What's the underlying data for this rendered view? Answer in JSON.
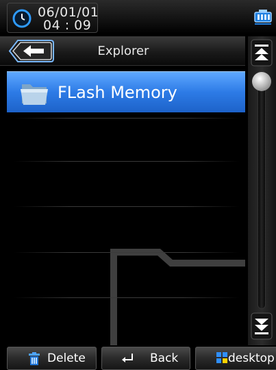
{
  "status_bar": {
    "date": "06/01/01",
    "time": "04 : 09",
    "clock_icon": "clock-icon",
    "battery_icon": "battery-icon",
    "accent_color": "#3aa0ff"
  },
  "title_bar": {
    "title": "Explorer",
    "back_icon": "back-arrow-icon"
  },
  "list": {
    "items": [
      {
        "label": "FLash Memory",
        "icon": "folder-icon",
        "selected": true
      }
    ],
    "selected_color": "#2d7be6"
  },
  "scrollbar": {
    "up_icon": "scroll-up-icon",
    "down_icon": "scroll-down-icon"
  },
  "toolbar": {
    "delete_label": "Delete",
    "back_label": "Back",
    "desktop_label": "desktop",
    "delete_icon": "trash-icon",
    "back_icon": "return-arrow-icon",
    "desktop_icon": "grid-icon"
  }
}
